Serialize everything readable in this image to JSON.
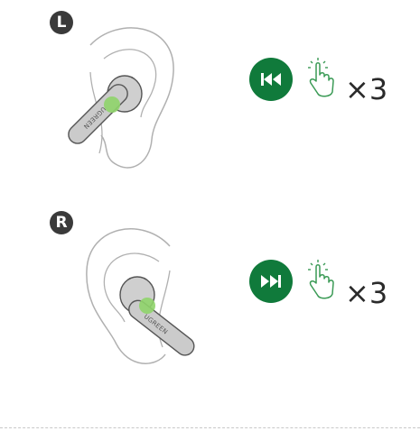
{
  "sections": [
    {
      "side_label": "L",
      "earbud_brand": "UGREEN",
      "action_icon": "previous-track-icon",
      "gesture_icon": "tap-hand-icon",
      "tap_count_label": "×3"
    },
    {
      "side_label": "R",
      "earbud_brand": "UGREEN",
      "action_icon": "next-track-icon",
      "gesture_icon": "tap-hand-icon",
      "tap_count_label": "×3"
    }
  ],
  "colors": {
    "accent_green": "#107a3b",
    "touch_area_green": "#8fd46a",
    "badge_dark": "#3a3a3a",
    "earbud_gray": "#c9c9c9",
    "outline": "#666666"
  }
}
